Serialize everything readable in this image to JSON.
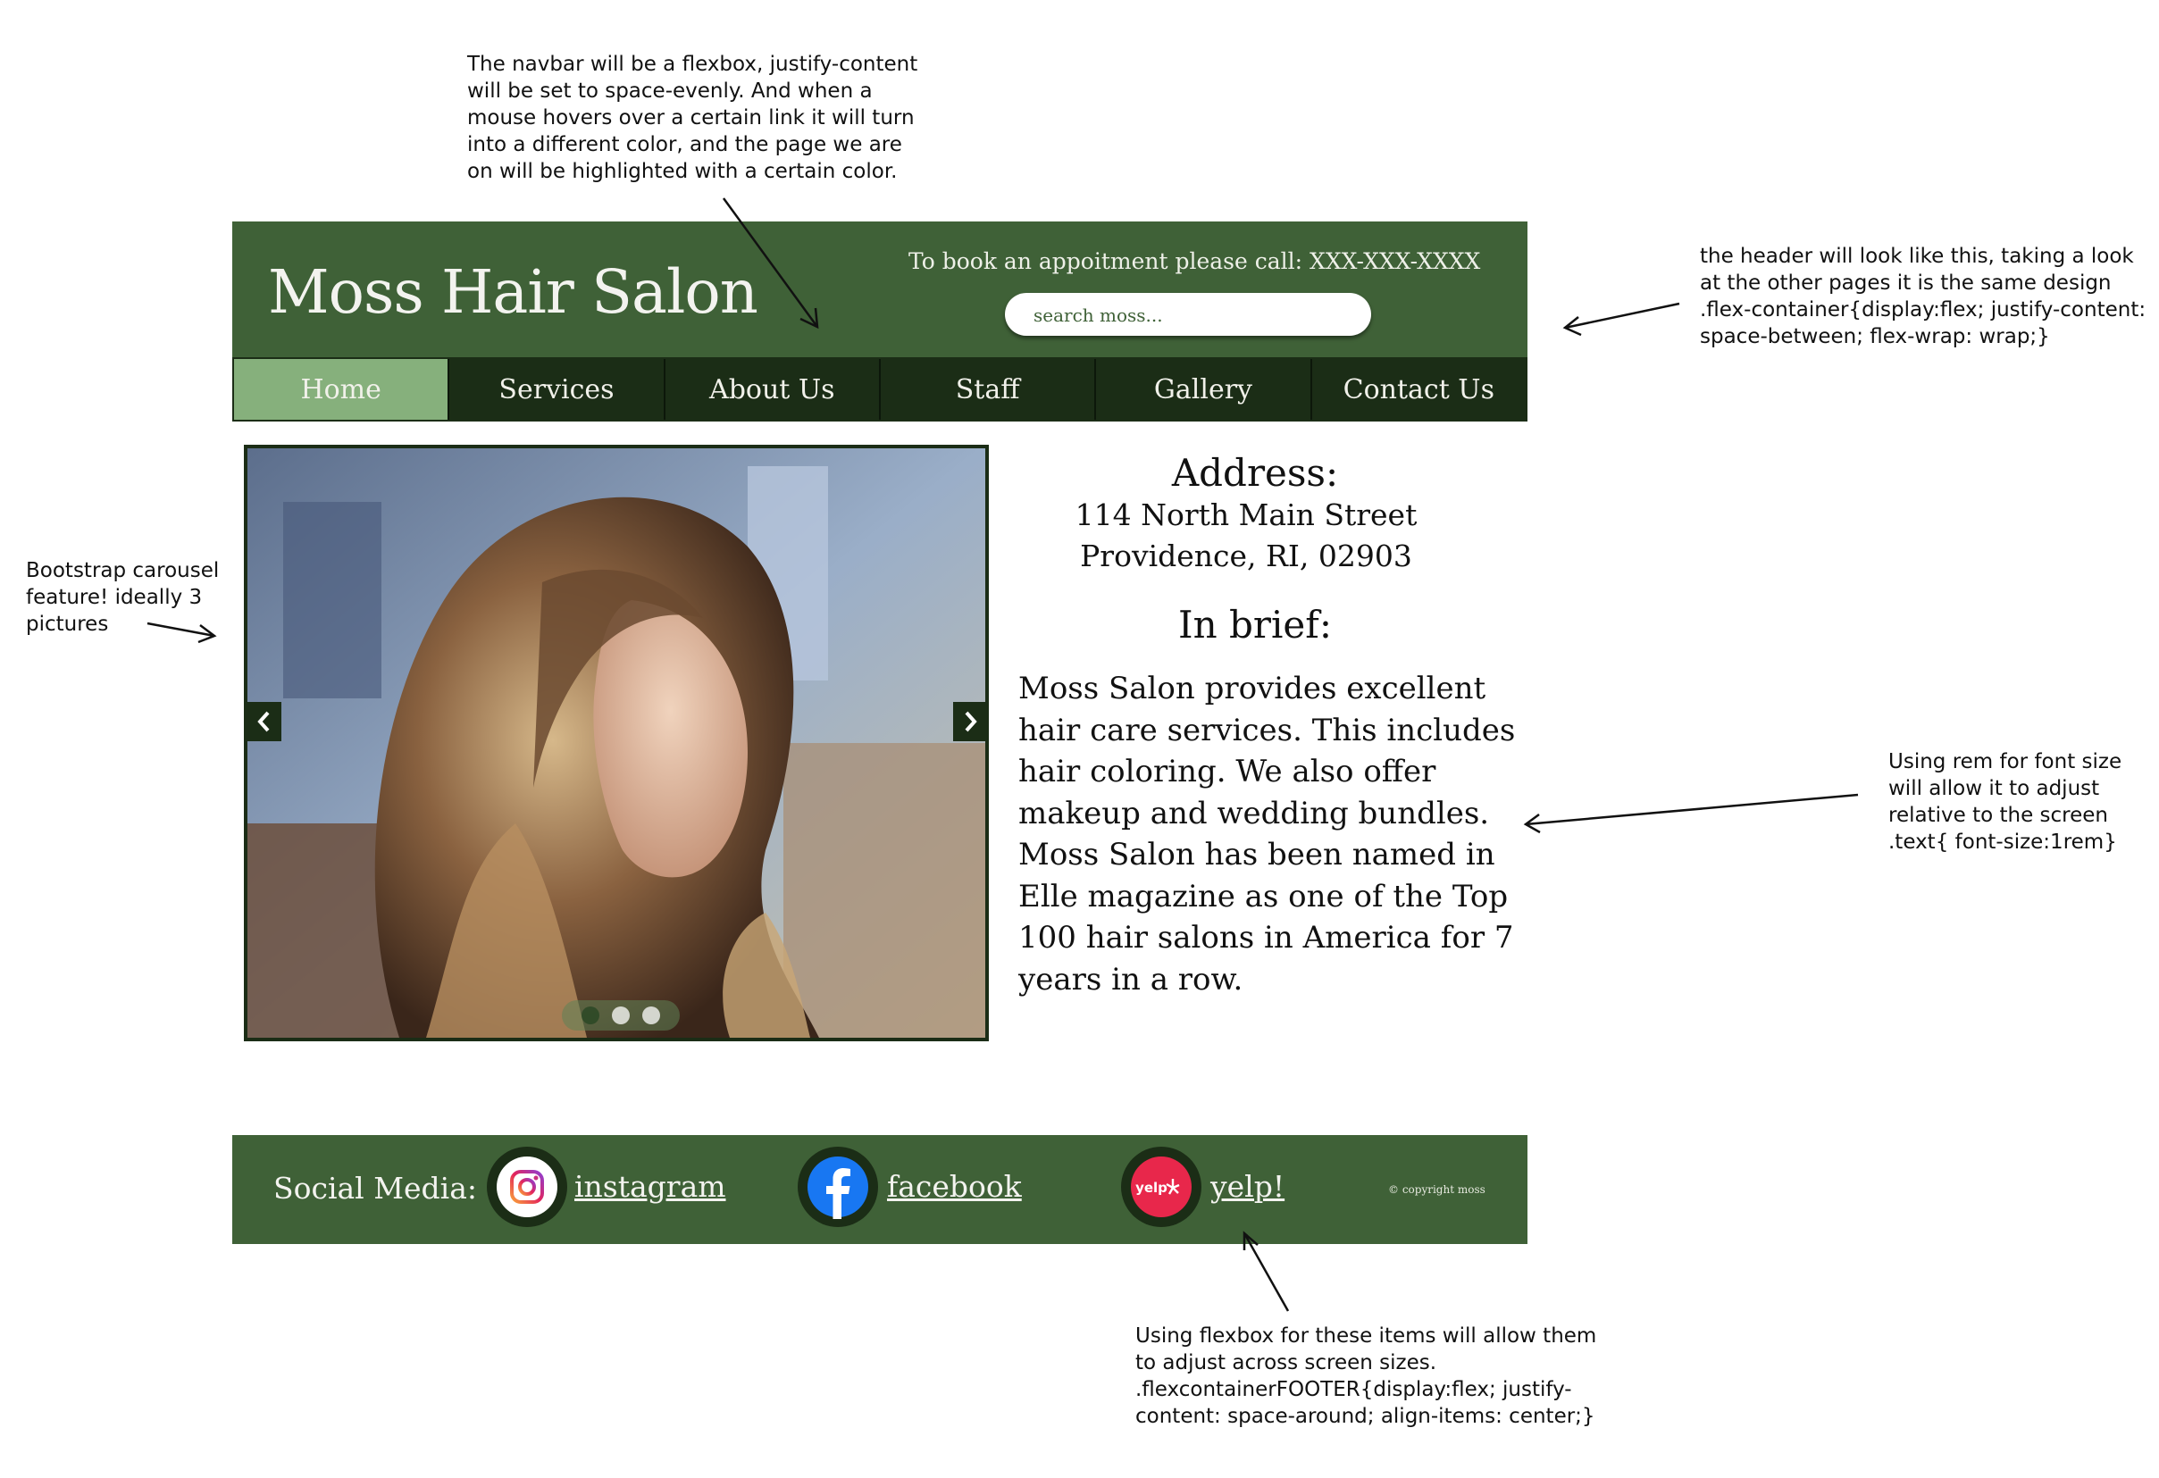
{
  "annotations": {
    "navbar": "The navbar will be a flexbox, justify-content\nwill be set to space-evenly. And when a\nmouse hovers over a certain link it will turn\ninto a different color, and the page we are\non will be highlighted with a certain color.",
    "header": "the header will look like this, taking a look\nat the other pages it is the same design\n.flex-container{display:flex; justify-content:\nspace-between;  flex-wrap: wrap;}",
    "carousel": "Bootstrap carousel\nfeature! ideally 3\npictures",
    "rem": "Using rem for font size\nwill allow it to adjust\nrelative to the screen\n.text{ font-size:1rem}",
    "footer": "Using flexbox for these items will allow them\nto adjust across screen sizes.\n.flexcontainerFOOTER{display:flex; justify-\ncontent: space-around; align-items: center;}"
  },
  "header": {
    "title": "Moss Hair Salon",
    "booking": "To book an appoitment please call: XXX-XXX-XXXX",
    "search_placeholder": "search moss..."
  },
  "nav": {
    "items": [
      "Home",
      "Services",
      "About Us",
      "Staff",
      "Gallery",
      "Contact Us"
    ],
    "active_index": 0
  },
  "carousel": {
    "slide_count": 3,
    "active_slide": 1
  },
  "info": {
    "address_heading": "Address:",
    "address_line1": "114 North Main Street",
    "address_line2": "Providence, RI, 02903",
    "brief_heading": "In brief:",
    "brief_text": "Moss Salon provides excellent hair care services. This includes hair coloring. We also offer makeup and wedding bundles. Moss Salon has been named in Elle magazine as one of the Top 100 hair salons in America for 7 years in a row."
  },
  "footer": {
    "label": "Social Media:",
    "links": [
      "instagram",
      "facebook",
      "yelp!"
    ],
    "yelp_logo_text": "yelp",
    "copyright": "© copyright moss"
  },
  "colors": {
    "header_green": "#3f6137",
    "nav_dark": "#1b2d16",
    "nav_active": "#86b07c"
  }
}
